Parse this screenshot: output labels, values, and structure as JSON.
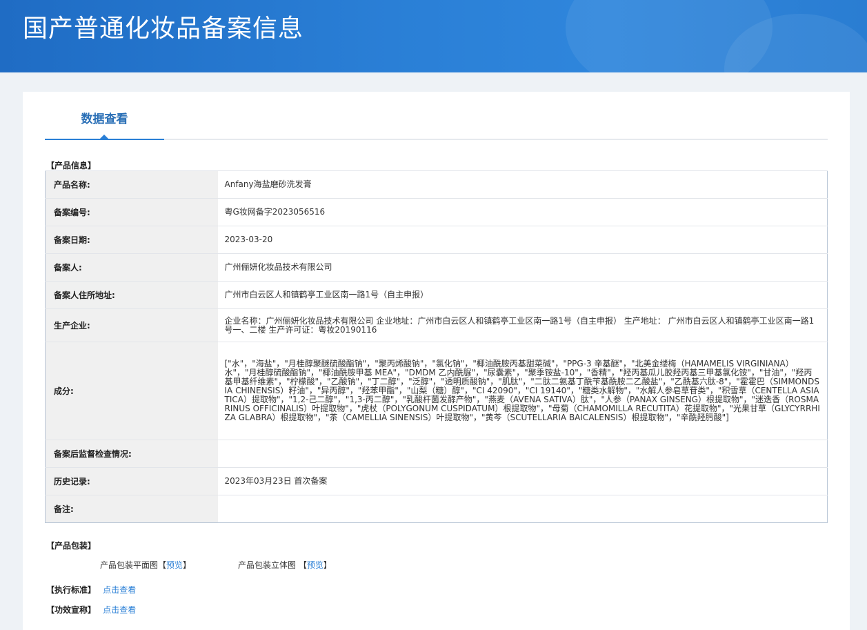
{
  "header": {
    "title": "国产普通化妆品备案信息"
  },
  "tabs": [
    {
      "label": "数据查看"
    }
  ],
  "product_info": {
    "section_title": "【产品信息】",
    "rows": [
      {
        "label": "产品名称:",
        "value": "Anfany海盐磨砂洗发膏"
      },
      {
        "label": "备案编号:",
        "value": "粤G妆网备字2023056516"
      },
      {
        "label": "备案日期:",
        "value": "2023-03-20"
      },
      {
        "label": "备案人:",
        "value": "广州俪妍化妆品技术有限公司"
      },
      {
        "label": "备案人住所地址:",
        "value": "广州市白云区人和镇鹤亭工业区南一路1号（自主申报）"
      },
      {
        "label": "生产企业:",
        "value": "企业名称：广州俪妍化妆品技术有限公司 企业地址：广州市白云区人和镇鹤亭工业区南一路1号（自主申报） 生产地址： 广州市白云区人和镇鹤亭工业区南一路1号一、二楼 生产许可证：粤妆20190116"
      },
      {
        "label": "成分:",
        "value": "[\"水\"，\"海盐\"，\"月桂醇聚醚硫酸酯钠\"，\"聚丙烯酸钠\"，\"氯化钠\"，\"椰油酰胺丙基甜菜碱\"，\"PPG-3 辛基醚\"，\"北美金缕梅（HAMAMELIS VIRGINIANA）水\"，\"月桂醇硫酸酯钠\"，\"椰油酰胺甲基 MEA\"，\"DMDM 乙内酰脲\"，\"尿囊素\"，\"聚季铵盐-10\"，\"香精\"，\"羟丙基瓜儿胶羟丙基三甲基氯化铵\"，\"甘油\"，\"羟丙基甲基纤维素\"，\"柠檬酸\"，\"乙酸钠\"，\"丁二醇\"，\"泛醇\"，\"透明质酸钠\"，\"肌肽\"，\"二肽二氨基丁酰苄基酰胺二乙酸盐\"，\"乙酰基六肽-8\"，\"霍霍巴（SIMMONDSIA CHINENSIS）籽油\"，\"异丙醇\"，\"羟苯甲酯\"，\"山梨（糖）醇\"，\"CI 42090\"，\"CI 19140\"，\"糖类水解物\"，\"水解人参皂草苷类\"，\"积雪草（CENTELLA ASIATICA）提取物\"，\"1,2-己二醇\"，\"1,3-丙二醇\"，\"乳酸杆菌发酵产物\"，\"燕麦（AVENA SATIVA）肽\"，\"人参（PANAX GINSENG）根提取物\"，\"迷迭香（ROSMARINUS OFFICINALIS）叶提取物\"，\"虎杖（POLYGONUM CUSPIDATUM）根提取物\"，\"母菊（CHAMOMILLA RECUTITA）花提取物\"，\"光果甘草（GLYCYRRHIZA GLABRA）根提取物\"，\"茶（CAMELLIA SINENSIS）叶提取物\"，\"黄芩（SCUTELLARIA BAICALENSIS）根提取物\"，\"辛酰羟肟酸\"]"
      },
      {
        "label": "备案后监督检查情况:",
        "value": ""
      },
      {
        "label": "历史记录:",
        "value": "2023年03月23日 首次备案"
      },
      {
        "label": "备注:",
        "value": ""
      }
    ]
  },
  "packaging": {
    "section_title": "【产品包装】",
    "flat_label": "产品包装平面图",
    "flat_link": "预览",
    "solid_label": "产品包装立体图",
    "solid_link": "预览"
  },
  "standard": {
    "label": "【执行标准】",
    "link": "点击查看"
  },
  "efficacy": {
    "label": "【功效宣称】",
    "link": "点击查看"
  }
}
